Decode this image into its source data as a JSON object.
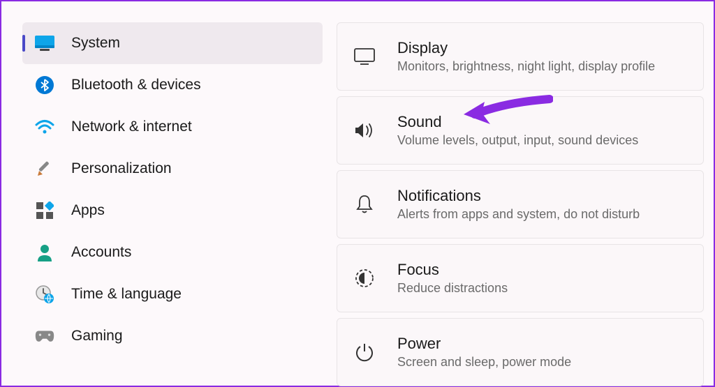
{
  "sidebar": {
    "items": [
      {
        "label": "System"
      },
      {
        "label": "Bluetooth & devices"
      },
      {
        "label": "Network & internet"
      },
      {
        "label": "Personalization"
      },
      {
        "label": "Apps"
      },
      {
        "label": "Accounts"
      },
      {
        "label": "Time & language"
      },
      {
        "label": "Gaming"
      }
    ]
  },
  "main": {
    "cards": [
      {
        "title": "Display",
        "desc": "Monitors, brightness, night light, display profile"
      },
      {
        "title": "Sound",
        "desc": "Volume levels, output, input, sound devices"
      },
      {
        "title": "Notifications",
        "desc": "Alerts from apps and system, do not disturb"
      },
      {
        "title": "Focus",
        "desc": "Reduce distractions"
      },
      {
        "title": "Power",
        "desc": "Screen and sleep, power mode"
      }
    ]
  }
}
